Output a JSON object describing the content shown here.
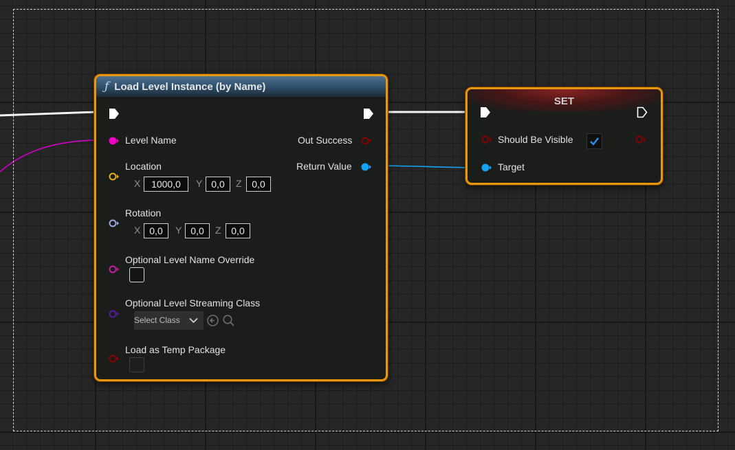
{
  "load_node": {
    "title": "Load Level Instance (by Name)",
    "icon": "function-icon",
    "inputs": {
      "level_name": "Level Name",
      "location": {
        "label": "Location",
        "x_label": "X",
        "x": "1000,0",
        "y_label": "Y",
        "y": "0,0",
        "z_label": "Z",
        "z": "0,0"
      },
      "rotation": {
        "label": "Rotation",
        "x_label": "X",
        "x": "0,0",
        "y_label": "Y",
        "y": "0,0",
        "z_label": "Z",
        "z": "0,0"
      },
      "optional_name_override": "Optional Level Name Override",
      "optional_streaming_class": {
        "label": "Optional Level Streaming Class",
        "selected": "Select Class"
      },
      "load_as_temp_package": "Load as Temp Package"
    },
    "outputs": {
      "out_success": "Out Success",
      "return_value": "Return Value"
    }
  },
  "set_node": {
    "title": "SET",
    "inputs": {
      "should_be_visible": "Should Be Visible",
      "should_be_visible_checked": true,
      "target": "Target"
    }
  },
  "colors": {
    "selected_border": "#e8960f",
    "string_pin": "#f000c8",
    "vector_pin": "#e6b01c",
    "rotator_pin": "#98a8e4",
    "name_pin": "#c81ca0",
    "class_pin": "#5a1aa0",
    "bool_pin": "#8a0000",
    "object_pin": "#12a4f4",
    "exec_wire": "#ffffff"
  }
}
